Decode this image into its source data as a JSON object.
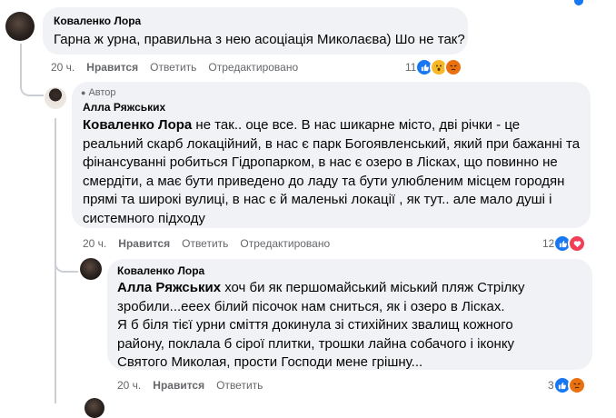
{
  "comment1": {
    "author": "Коваленко Лора",
    "text": "Гарна ж урна, правильна з нею асоціація Миколаєва) Шо не так?",
    "time": "20 ч.",
    "like": "Нравится",
    "reply": "Ответить",
    "edited": "Отредактировано",
    "reaction_count": "11",
    "reactions": [
      "like-icon",
      "wow-icon",
      "angry-icon"
    ]
  },
  "comment2": {
    "badge": "Автор",
    "author": "Алла Ряжських",
    "mention": "Коваленко Лора",
    "text": " не так.. оце все. В нас шикарне місто, дві річки - це реальний скарб локаційний, в нас є парк Богоявленський, який при бажанні та фінансуванні робиться Гідропарком, в нас є озеро в Лісках, що повинно не смердіти, а має бути приведено до ладу та бути улюбленим місцем городян прямі та широкі вулиці, в нас є й маленькі локації , як тут.. але мало душі і системного підходу",
    "time": "20 ч.",
    "like": "Нравится",
    "reply": "Ответить",
    "edited": "Отредактировано",
    "reaction_count": "12",
    "reactions": [
      "like-icon",
      "love-icon"
    ]
  },
  "comment3": {
    "author": "Коваленко Лора",
    "mention": "Алла Ряжських",
    "text": " хоч би як першомайський міський пляж Стрілку зробили...еееx білий пісочок нам сниться, як і озеро в Лісках.",
    "text2": "Я б біля тієї урни сміття докинула зі стихійних звалищ кожного району, поклала б сірої плитки, трошки лайна собачого і іконку Святого Миколая, прости Господи мене грішну...",
    "time": "20 ч.",
    "like": "Нравится",
    "reply": "Ответить",
    "reaction_count": "3",
    "reactions": [
      "like-icon",
      "angry-icon"
    ]
  },
  "colors": {
    "bubble": "#f0f2f5",
    "meta": "#65676b",
    "like": "#1877f2"
  }
}
